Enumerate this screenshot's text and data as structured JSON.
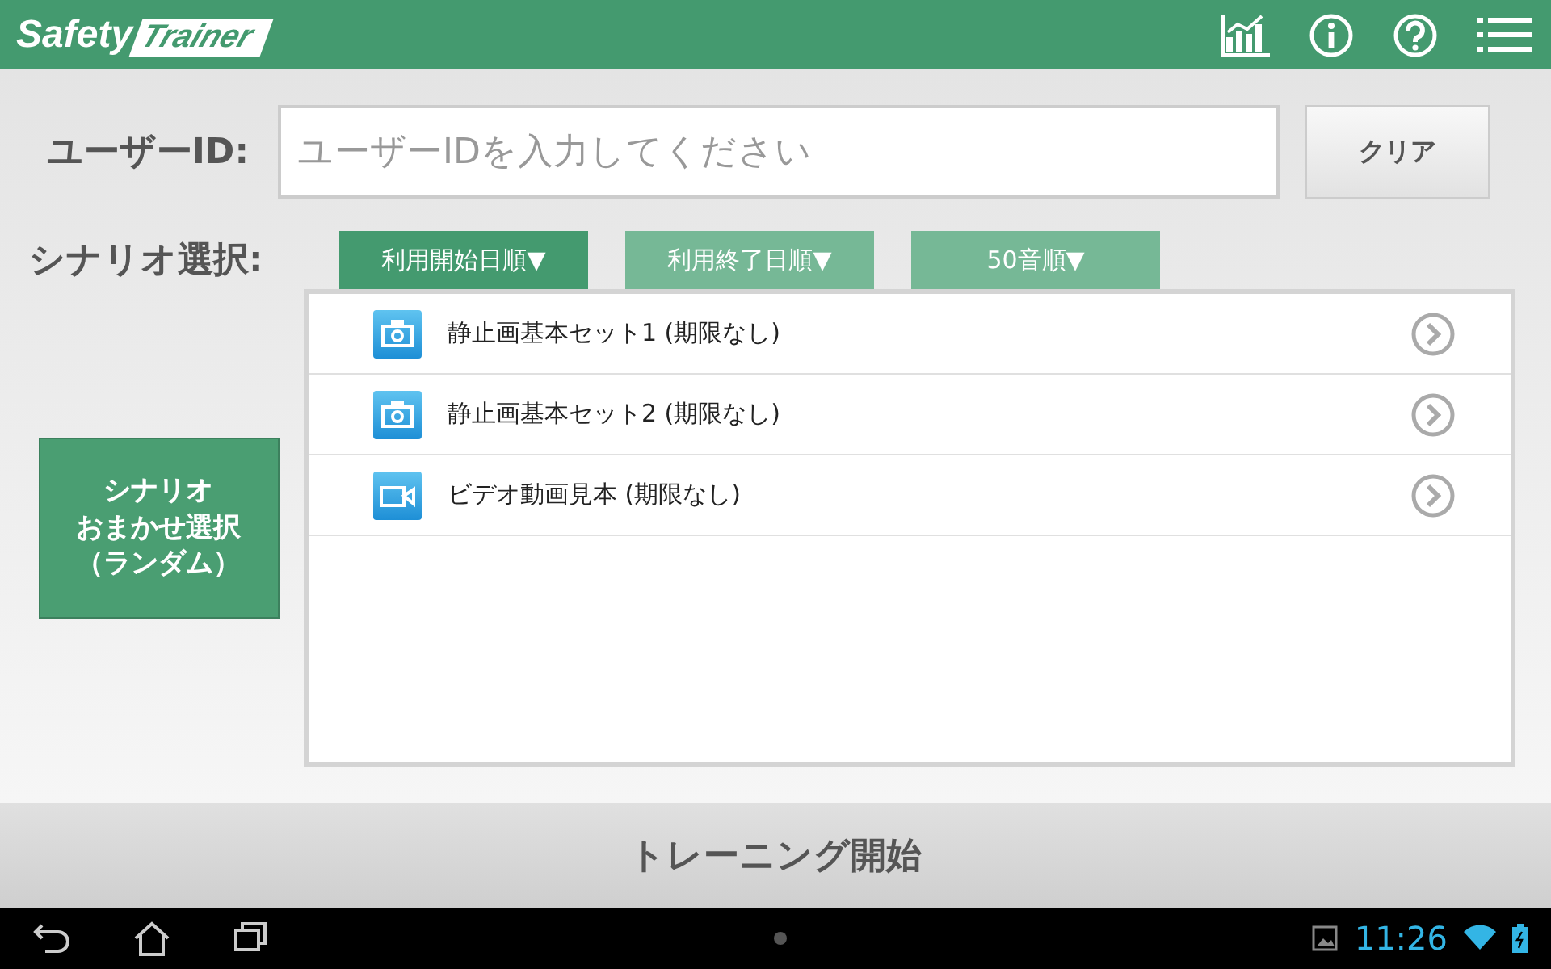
{
  "header": {
    "logo_left": "Safety",
    "logo_right": "Trainer"
  },
  "user_id": {
    "label": "ユーザーID:",
    "placeholder": "ユーザーIDを入力してください",
    "clear_button": "クリア"
  },
  "scenario": {
    "label": "シナリオ選択:",
    "sort_buttons": [
      {
        "label": "利用開始日順▼",
        "selected": true
      },
      {
        "label": "利用終了日順▼",
        "selected": false
      },
      {
        "label": "50音順▼",
        "selected": false
      }
    ],
    "random_button": [
      "シナリオ",
      "おまかせ選択",
      "（ランダム）"
    ],
    "items": [
      {
        "kind": "photo",
        "title": "静止画基本セット1 (期限なし)"
      },
      {
        "kind": "photo",
        "title": "静止画基本セット2 (期限なし)"
      },
      {
        "kind": "video",
        "title": "ビデオ動画見本 (期限なし)"
      }
    ]
  },
  "start_button": "トレーニング開始",
  "status_bar": {
    "time": "11:26"
  }
}
